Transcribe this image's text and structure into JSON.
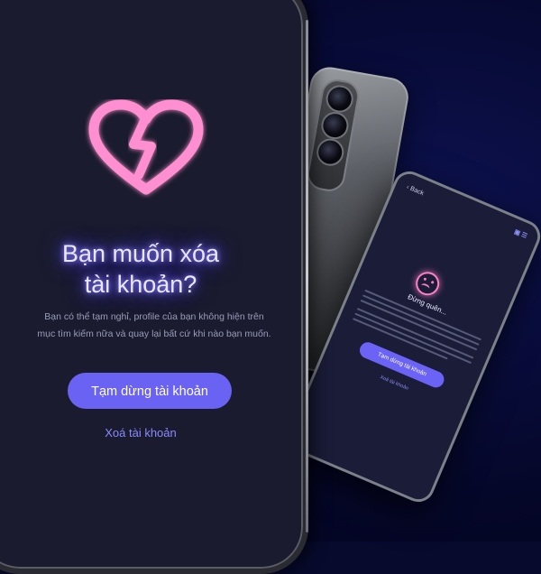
{
  "main_screen": {
    "icon": "broken-heart-icon",
    "title_line1": "Bạn muốn xóa",
    "title_line2": "tài khoản?",
    "description_line1": "Bạn có thể tạm nghỉ, profile của bạn không hiện trên",
    "description_line2": "mục tìm kiếm nữa và quay lại bất cứ khi nào bạn muốn.",
    "primary_button": "Tạm dừng tài khoản",
    "secondary_link": "Xoá tài khoản"
  },
  "secondary_phone": {
    "back_label": "‹ Back",
    "icon": "sad-face-icon",
    "title": "Đừng quên...",
    "primary_button": "Tạm dừng tài khoản",
    "secondary_link": "Xoá tài khoản"
  },
  "colors": {
    "background": "#070a2c",
    "screen": "#1a1b2e",
    "accent": "#6a62f2",
    "heart": "#ff8fd0",
    "title_glow": "#6b5cff"
  }
}
